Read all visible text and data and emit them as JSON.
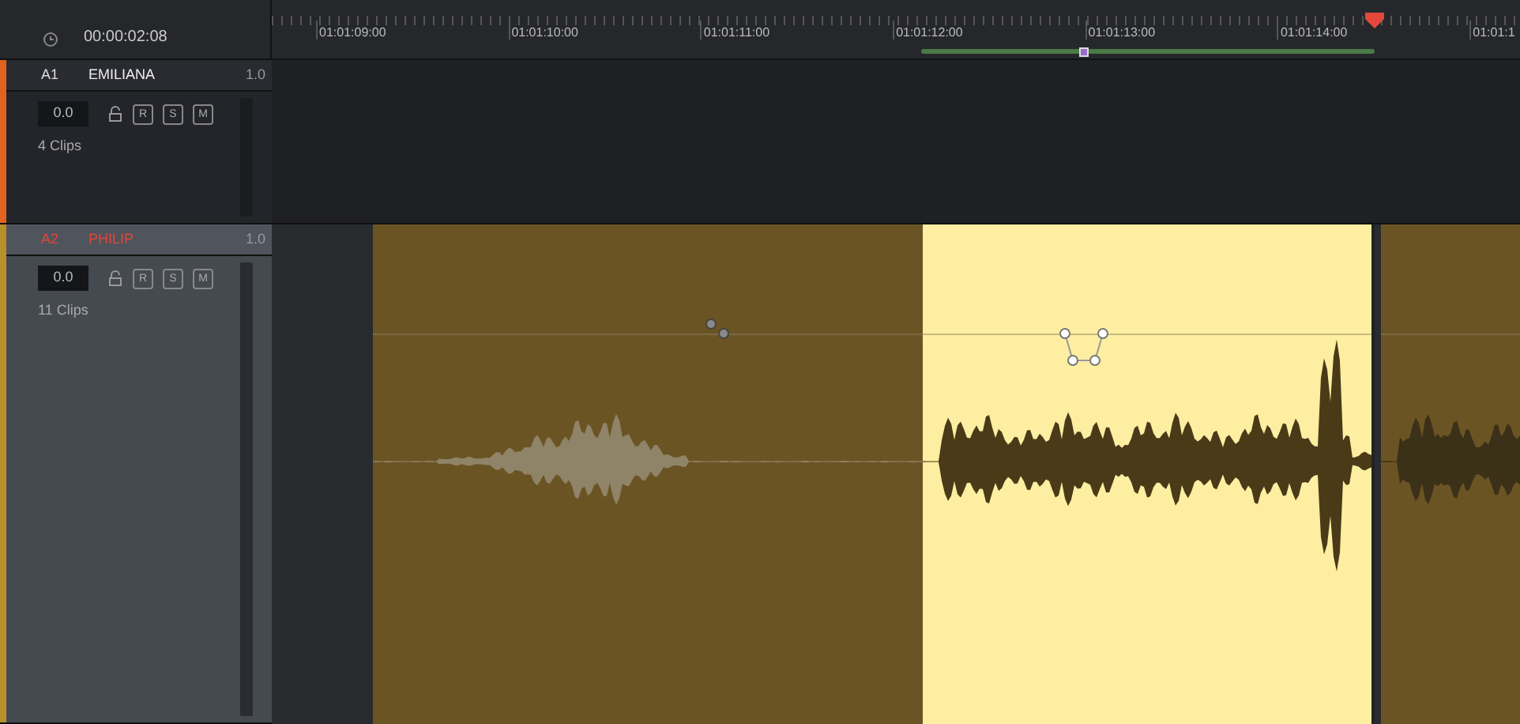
{
  "header": {
    "timecode": "00:00:02:08"
  },
  "ruler": {
    "labels": [
      "01:01:09:00",
      "01:01:10:00",
      "01:01:11:00",
      "01:01:12:00",
      "01:01:13:00",
      "01:01:14:00",
      "01:01:1"
    ]
  },
  "tracks": [
    {
      "id": "A1",
      "name": "EMILIANA",
      "volume": "1.0",
      "level_value": "0.0",
      "buttons": [
        "R",
        "S",
        "M"
      ],
      "clip_count": "4 Clips",
      "selected": false,
      "color": "#e0641e"
    },
    {
      "id": "A2",
      "name": "PHILIP",
      "volume": "1.0",
      "level_value": "0.0",
      "buttons": [
        "R",
        "S",
        "M"
      ],
      "clip_count": "11 Clips",
      "selected": true,
      "color": "#b8902a",
      "clips": [
        {
          "selected": false
        },
        {
          "selected": true
        },
        {
          "selected": false
        }
      ]
    }
  ]
}
